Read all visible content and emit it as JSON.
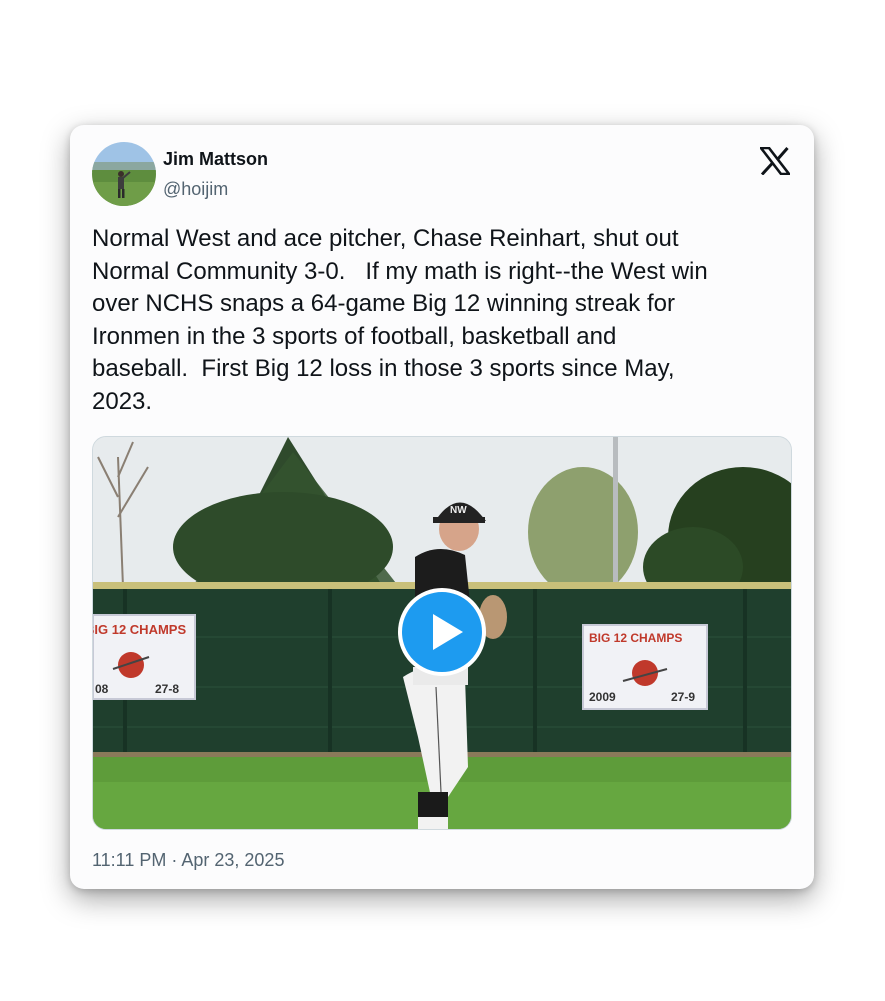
{
  "tweet": {
    "author_name": "Jim Mattson",
    "author_handle": "@hoijim",
    "text": "Normal West and ace pitcher, Chase Reinhart, shut out\nNormal Community 3-0.   If my math is right--the West win\nover NCHS snaps a 64-game Big 12 winning streak for\nIronmen in the 3 sports of football, basketball and\nbaseball.  First Big 12 loss in those 3 sports since May,\n2023.",
    "timestamp": "11:11 PM · Apr 23, 2025"
  },
  "icons": {
    "brand": "x-logo-icon",
    "media_action": "play-icon"
  },
  "media": {
    "banner_left": {
      "title": "BIG 12 CHAMPS",
      "year_left": "08",
      "record": "27-8"
    },
    "banner_right": {
      "title": "BIG 12 CHAMPS",
      "year": "2009",
      "record": "27-9"
    },
    "cap_logo": "NW"
  },
  "colors": {
    "play_button": "#1d9bf0",
    "text_primary": "#0f1419",
    "text_secondary": "#536471"
  }
}
